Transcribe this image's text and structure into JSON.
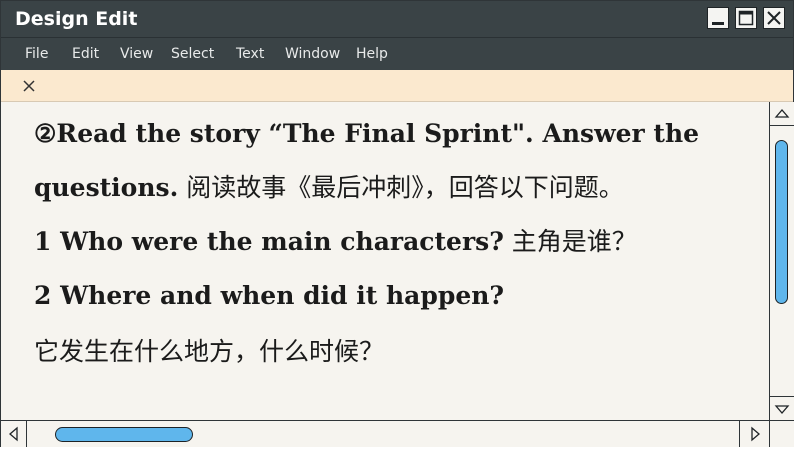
{
  "window": {
    "title": "Design Edit"
  },
  "menu": [
    "File",
    "Edit",
    "View",
    "Select",
    "Text",
    "Window",
    "Help"
  ],
  "content": {
    "line1": "②Read the story “The Final Sprint\". Answer the",
    "line2_en": "questions.",
    "line2_zh": " 阅读故事《最后冲刺》，回答以下问题。",
    "line3_en": "1 Who were the main characters?",
    "line3_zh": " 主角是谁？",
    "line4": "2 Where and when did it happen?",
    "line5": "它发生在什么地方，什么时候？"
  },
  "scroll": {
    "vertical_position": 0.1,
    "horizontal_position": 0.05
  },
  "icons": {
    "minimize": "minimize-icon",
    "maximize": "maximize-icon",
    "close": "close-icon",
    "tab_close": "close-icon",
    "scroll_up": "triangle-up-icon",
    "scroll_down": "triangle-down-icon",
    "scroll_left": "triangle-left-icon",
    "scroll_right": "triangle-right-icon"
  },
  "colors": {
    "titlebar": "#3a4346",
    "tabstrip": "#fbe9cf",
    "content_bg": "#f6f4ef",
    "scroll_thumb": "#5fb6ec"
  }
}
